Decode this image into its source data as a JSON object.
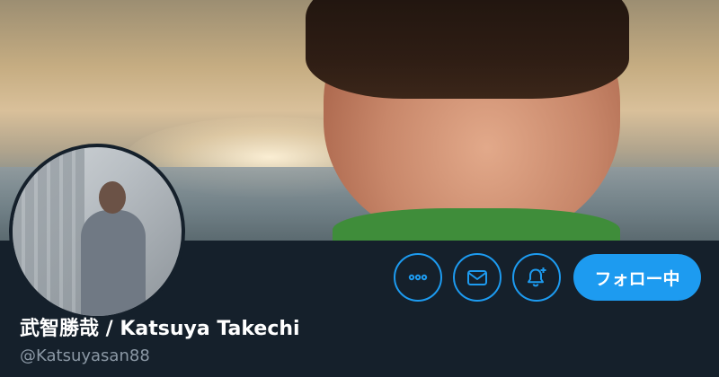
{
  "profile": {
    "display_name": "武智勝哉 / Katsuya Takechi",
    "handle": "@Katsuyasan88"
  },
  "actions": {
    "more_icon": "more-horizontal-icon",
    "message_icon": "envelope-icon",
    "notify_icon": "bell-plus-icon",
    "follow_label": "フォロー中"
  },
  "colors": {
    "background": "#15202b",
    "accent": "#1d9bf0",
    "secondary_text": "#8b98a5",
    "primary_text": "#ffffff"
  }
}
